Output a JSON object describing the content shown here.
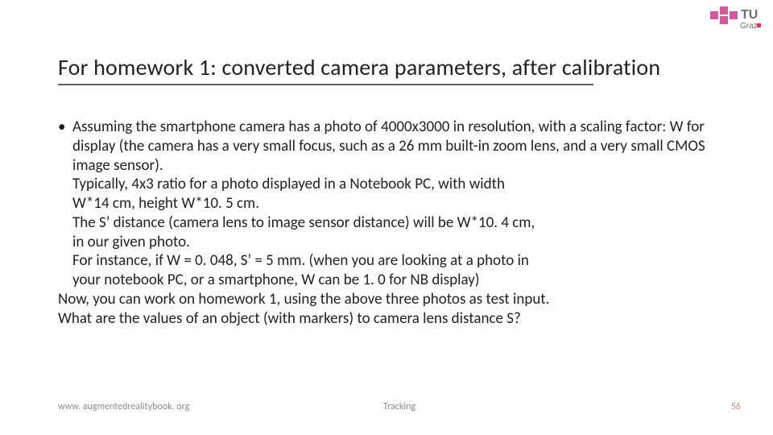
{
  "logo": {
    "label_top": "TU",
    "label_bottom": "Graz",
    "accent": "#d15a9c",
    "accent2": "#d6364f"
  },
  "title": "For homework 1: converted camera parameters, after calibration",
  "body": {
    "bullet1": "Assuming the smartphone camera has a photo of 4000x3000 in resolution,   with a scaling factor: W for display (the camera has a very small focus, such as a 26 mm built-in zoom lens, and a very small CMOS image sensor).",
    "line_typ": "Typically, 4x3 ratio for a photo displayed in a Notebook PC, with width",
    "line_dim": "W*14 cm, height W*10. 5 cm.",
    "line_sdist": "The S’ distance (camera lens to image sensor distance) will be W*10. 4 cm,",
    "line_given": " in our given photo.",
    "line_inst": "For instance, if W = 0. 048, S’ = 5 mm. (when you are looking at a photo in",
    "line_nb": "your notebook PC, or a smartphone, W can be 1. 0 for NB display)",
    "line_now": "Now, you can work on homework 1, using the above three photos as test input.",
    "line_q": "What are the values of an object (with markers) to camera lens distance S?"
  },
  "footer": {
    "left": "www. augmentedrealitybook. org",
    "center": "Tracking",
    "right": "56"
  }
}
